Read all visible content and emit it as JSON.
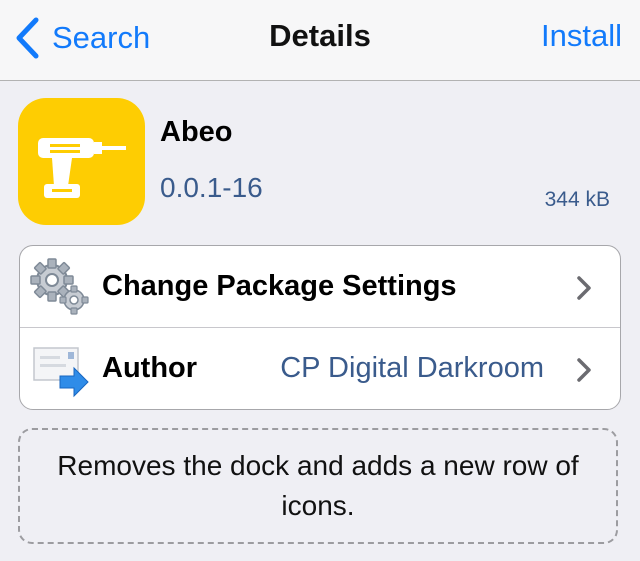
{
  "navbar": {
    "back_label": "Search",
    "title": "Details",
    "action_label": "Install"
  },
  "package": {
    "name": "Abeo",
    "version": "0.0.1-16",
    "size": "344 kB",
    "icon": "drill-icon"
  },
  "actions": [
    {
      "label": "Change Package Settings",
      "value": "",
      "icon": "gears-icon"
    },
    {
      "label": "Author",
      "value": "CP Digital Darkroom",
      "icon": "mail-forward-icon"
    }
  ],
  "description": "Removes the dock and adds a new row of icons.",
  "colors": {
    "accent": "#127afb",
    "value_text": "#3a5b8c",
    "icon_background": "#fecd02"
  }
}
